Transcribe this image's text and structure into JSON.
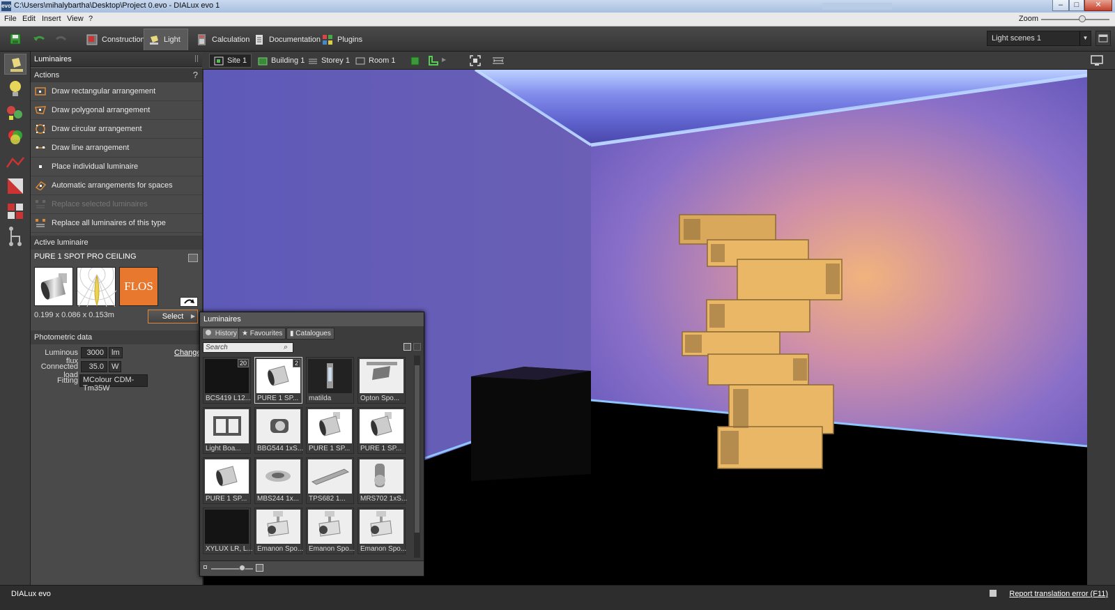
{
  "window": {
    "title": "C:\\Users\\mihalybartha\\Desktop\\Project 0.evo - DIALux evo 1",
    "app_icon": "evo",
    "controls": [
      "minimize-icon",
      "maximize-icon",
      "close-icon"
    ]
  },
  "menu": {
    "items": [
      "File",
      "Edit",
      "Insert",
      "View",
      "?"
    ],
    "zoom_label": "Zoom"
  },
  "toolbar": {
    "tabs": [
      {
        "label": "Construction",
        "icon": "construction-icon"
      },
      {
        "label": "Light",
        "icon": "lamp-icon",
        "active": true
      },
      {
        "label": "Calculation",
        "icon": "calculator-icon"
      },
      {
        "label": "Documentation",
        "icon": "document-icon"
      },
      {
        "label": "Plugins",
        "icon": "plugins-icon"
      }
    ],
    "light_scenes": "Light scenes 1"
  },
  "left_panel": {
    "title": "Luminaires",
    "actions_header": "Actions",
    "help": "?",
    "actions": [
      {
        "label": "Draw rectangular arrangement",
        "enabled": true
      },
      {
        "label": "Draw polygonal arrangement",
        "enabled": true
      },
      {
        "label": "Draw circular arrangement",
        "enabled": true
      },
      {
        "label": "Draw line arrangement",
        "enabled": true
      },
      {
        "label": "Place individual luminaire",
        "enabled": true
      },
      {
        "label": "Automatic arrangements for spaces",
        "enabled": true
      },
      {
        "label": "Replace selected luminaires",
        "enabled": false
      },
      {
        "label": "Replace all luminaires of this type",
        "enabled": true
      }
    ],
    "active_luminaire_header": "Active luminaire",
    "luminaire_name": "PURE 1 SPOT PRO CEILING",
    "brand_logo": "FLOS",
    "dimensions": "0.199 x 0.086 x 0.153m",
    "select_label": "Select",
    "photometric_header": "Photometric data",
    "luminous_flux_label": "Luminous flux",
    "luminous_flux_value": "3000",
    "luminous_flux_unit": "lm",
    "connected_load_label": "Connected load",
    "connected_load_value": "35.0",
    "connected_load_unit": "W",
    "fitting_label": "Fitting",
    "fitting_value": "MColour CDM-Tm35W",
    "change_label": "Change"
  },
  "view_toolbar": {
    "breadcrumbs": [
      "Site 1",
      "Building 1",
      "Storey 1",
      "Room 1"
    ]
  },
  "browser": {
    "title": "Luminaires",
    "tabs": [
      "History",
      "Favourites",
      "Catalogues"
    ],
    "search_placeholder": "Search",
    "tiles": [
      {
        "label": "BCS419 L12...",
        "badge": "20"
      },
      {
        "label": "PURE 1 SP...",
        "badge": "2"
      },
      {
        "label": "matilda",
        "badge": ""
      },
      {
        "label": "Opton Spo...",
        "badge": ""
      },
      {
        "label": "Light Boa...",
        "badge": ""
      },
      {
        "label": "BBG544 1xS...",
        "badge": ""
      },
      {
        "label": "PURE 1 SP...",
        "badge": ""
      },
      {
        "label": "PURE 1 SP...",
        "badge": ""
      },
      {
        "label": "PURE 1 SP...",
        "badge": ""
      },
      {
        "label": "MBS244 1x...",
        "badge": ""
      },
      {
        "label": "TPS682 1...",
        "badge": ""
      },
      {
        "label": "MRS702 1xS...",
        "badge": ""
      },
      {
        "label": "XYLUX LR, L...",
        "badge": ""
      },
      {
        "label": "Emanon Spo...",
        "badge": ""
      },
      {
        "label": "Emanon Spo...",
        "badge": ""
      },
      {
        "label": "Emanon Spo...",
        "badge": ""
      }
    ]
  },
  "status": {
    "app_name": "DIALux evo",
    "report_link": "Report translation error (F11)"
  }
}
